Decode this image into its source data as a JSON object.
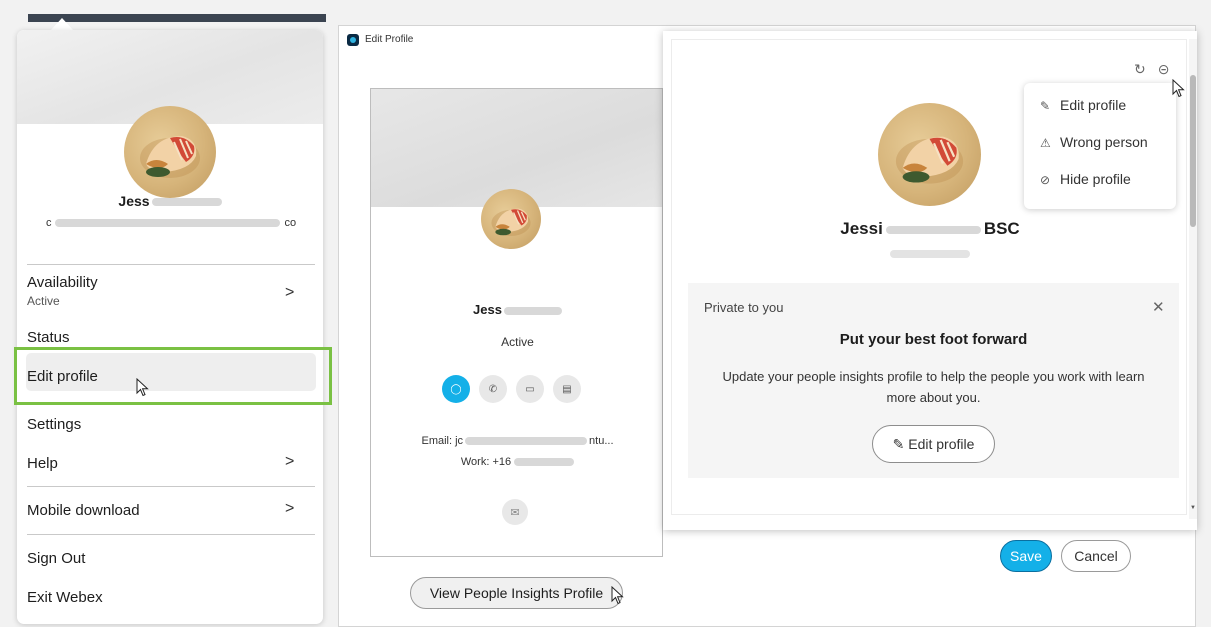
{
  "left_menu": {
    "name": "Jess",
    "email_start": "c",
    "email_end": "co",
    "availability": {
      "label": "Availability",
      "value": "Active"
    },
    "items": {
      "status": "Status",
      "edit_profile": "Edit profile",
      "settings": "Settings",
      "help": "Help",
      "mobile_download": "Mobile download",
      "sign_out": "Sign Out",
      "exit": "Exit Webex"
    }
  },
  "edit_window": {
    "title": "Edit Profile",
    "card": {
      "name": "Jess",
      "status": "Active",
      "email_prefix": "Email: jc",
      "email_suffix": "ntu...",
      "work": "Work: +16"
    },
    "view_insights_button": "View People Insights Profile",
    "save_button": "Save",
    "cancel_button": "Cancel"
  },
  "insights_panel": {
    "name_start": "Jessi",
    "name_end": "BSC",
    "menu": {
      "edit_profile": "Edit profile",
      "wrong_person": "Wrong person",
      "hide_profile": "Hide profile"
    },
    "private_box": {
      "label": "Private to you",
      "title": "Put your best foot forward",
      "text": "Update your people insights profile to help the people you work with learn more about you.",
      "button": "Edit profile"
    }
  },
  "colors": {
    "accent": "#14b0e8",
    "highlight_border": "#7ac143"
  }
}
